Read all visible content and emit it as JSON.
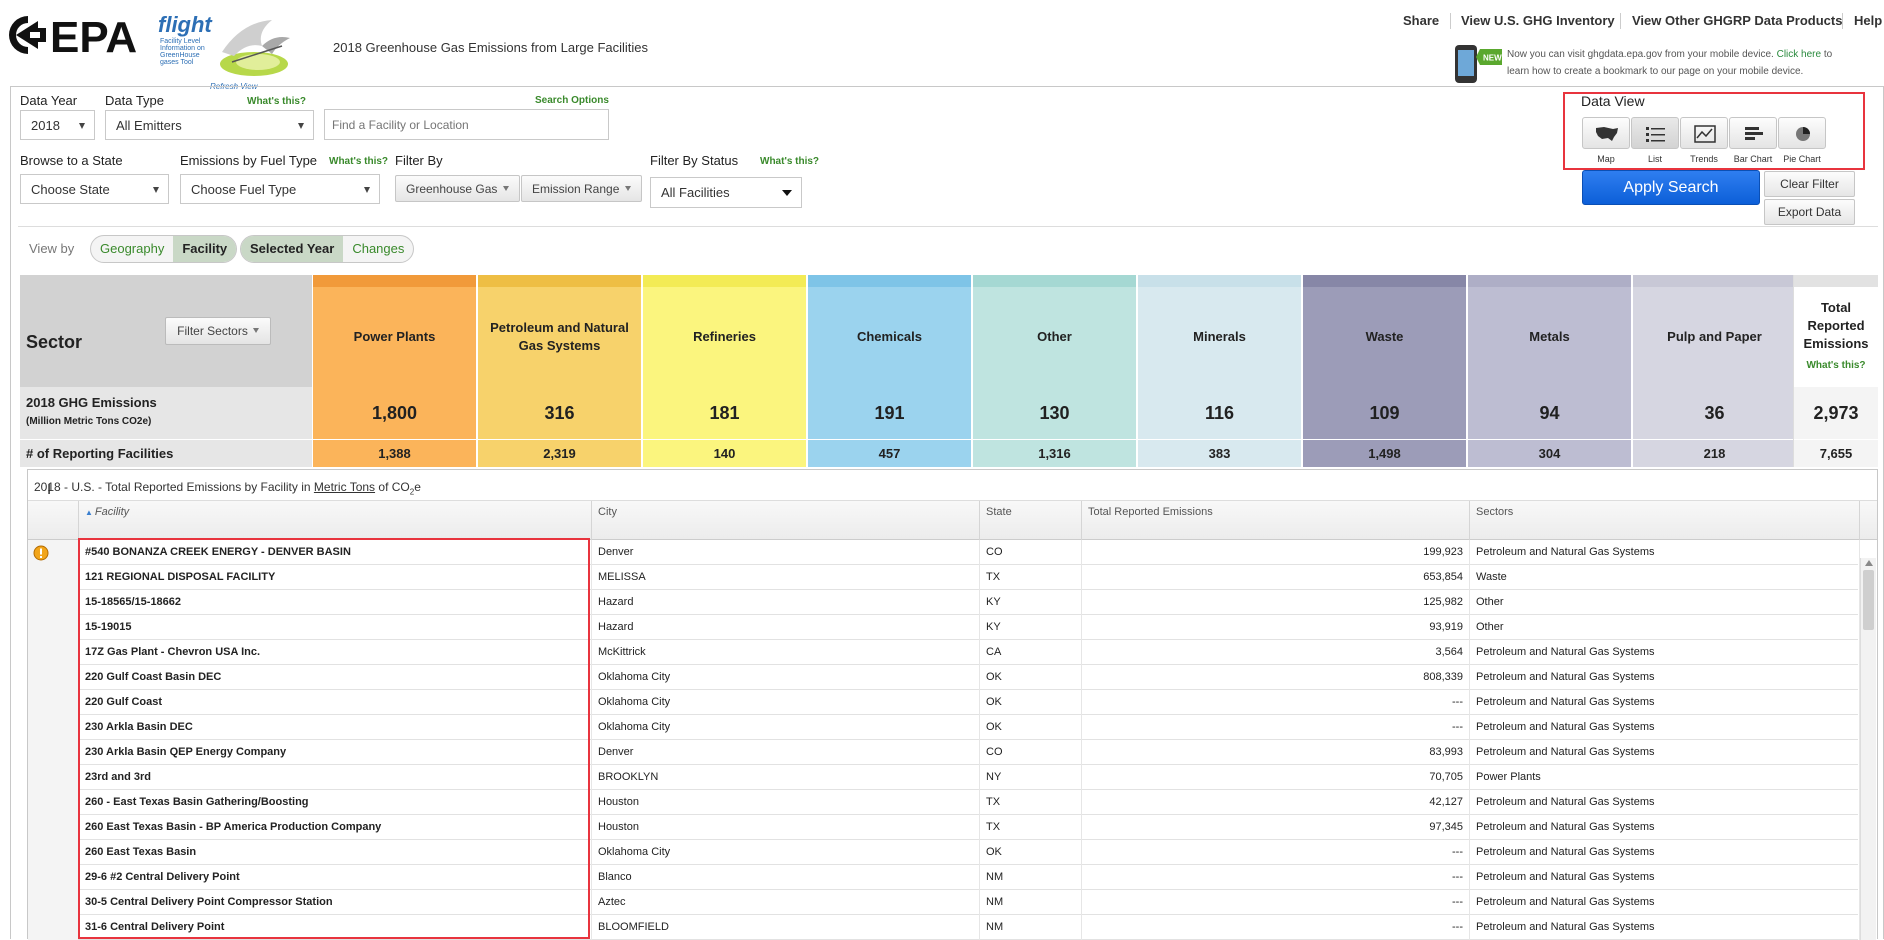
{
  "header": {
    "epa_logo": "EPA",
    "flight_word": "flight",
    "flight_sub": "Facility Level Information on GreenHouse gases Tool",
    "refresh_view": "Refresh View",
    "page_title": "2018 Greenhouse Gas Emissions from Large Facilities",
    "links": [
      "Share",
      "View U.S. GHG Inventory",
      "View Other GHGRP Data Products",
      "Help"
    ],
    "mobile_badge": "NEW!",
    "mobile_text": "Now you can visit ghgdata.epa.gov from your mobile device.",
    "mobile_link": "Click here",
    "mobile_text2": "to learn how to create a bookmark to our page on your mobile device."
  },
  "filters": {
    "data_year_label": "Data Year",
    "data_year_value": "2018",
    "data_type_label": "Data Type",
    "whats_this": "What's this?",
    "data_type_value": "All Emitters",
    "search_options": "Search Options",
    "search_placeholder": "Find a Facility or Location",
    "browse_state_label": "Browse to a State",
    "browse_state_value": "Choose State",
    "fuel_type_label": "Emissions by Fuel Type",
    "fuel_type_value": "Choose Fuel Type",
    "filter_by_label": "Filter By",
    "greenhouse_gas": "Greenhouse Gas",
    "emission_range": "Emission Range",
    "filter_status_label": "Filter By Status",
    "filter_status_value": "All Facilities"
  },
  "data_view": {
    "title": "Data View",
    "buttons": [
      {
        "label": "Map",
        "icon": "us-map-icon"
      },
      {
        "label": "List",
        "icon": "list-icon"
      },
      {
        "label": "Trends",
        "icon": "trends-icon"
      },
      {
        "label": "Bar Chart",
        "icon": "bar-chart-icon"
      },
      {
        "label": "Pie Chart",
        "icon": "pie-chart-icon"
      }
    ],
    "active": "List",
    "apply_search": "Apply Search",
    "clear_filter": "Clear Filter",
    "export_data": "Export Data"
  },
  "view_by": {
    "label": "View by",
    "geography": "Geography",
    "facility": "Facility",
    "selected_year": "Selected Year",
    "changes": "Changes"
  },
  "sector_table": {
    "sector_label": "Sector",
    "filter_sectors": "Filter Sectors",
    "emissions_row_label": "2018 GHG Emissions",
    "emissions_row_unit": "(Million Metric Tons CO2e)",
    "facilities_row_label": "# of Reporting Facilities",
    "total_label": "Total Reported Emissions",
    "total_whats_this": "What's this?",
    "total_emissions": "2,973",
    "total_facilities": "7,655",
    "sectors": [
      {
        "name": "Power Plants",
        "emissions": "1,800",
        "facilities": "1,388",
        "color": "#fbb45a",
        "band": "#f19a3a"
      },
      {
        "name": "Petroleum and Natural Gas Systems",
        "emissions": "316",
        "facilities": "2,319",
        "color": "#f7d26b",
        "band": "#eebe44"
      },
      {
        "name": "Refineries",
        "emissions": "181",
        "facilities": "140",
        "color": "#fbf57e",
        "band": "#f3eb55"
      },
      {
        "name": "Chemicals",
        "emissions": "191",
        "facilities": "457",
        "color": "#9bd3ee",
        "band": "#7ec4e7"
      },
      {
        "name": "Other",
        "emissions": "130",
        "facilities": "1,316",
        "color": "#bfe4e0",
        "band": "#a5d8d3"
      },
      {
        "name": "Minerals",
        "emissions": "116",
        "facilities": "383",
        "color": "#d8e9ef",
        "band": "#c8e0e9"
      },
      {
        "name": "Waste",
        "emissions": "109",
        "facilities": "1,498",
        "color": "#9c9cb8",
        "band": "#8787a7"
      },
      {
        "name": "Metals",
        "emissions": "94",
        "facilities": "304",
        "color": "#bdbdd2",
        "band": "#aeaec6"
      },
      {
        "name": "Pulp and Paper",
        "emissions": "36",
        "facilities": "218",
        "color": "#d6d6e1",
        "band": "#c8c8d6"
      }
    ]
  },
  "grid": {
    "caption_prefix": "2018 - U.S. - Total Reported Emissions by Facility in",
    "caption_unit": "Metric Tons",
    "caption_suffix": "of CO",
    "caption_sub": "2",
    "caption_end": "e",
    "columns": [
      "Facility",
      "City",
      "State",
      "Total Reported Emissions",
      "Sectors"
    ],
    "rows": [
      [
        "#540 BONANZA CREEK ENERGY - DENVER BASIN",
        "Denver",
        "CO",
        "199,923",
        "Petroleum and Natural Gas Systems"
      ],
      [
        "121 REGIONAL DISPOSAL FACILITY",
        "MELISSA",
        "TX",
        "653,854",
        "Waste"
      ],
      [
        "15-18565/15-18662",
        "Hazard",
        "KY",
        "125,982",
        "Other"
      ],
      [
        "15-19015",
        "Hazard",
        "KY",
        "93,919",
        "Other"
      ],
      [
        "17Z Gas Plant - Chevron USA Inc.",
        "McKittrick",
        "CA",
        "3,564",
        "Petroleum and Natural Gas Systems"
      ],
      [
        "220 Gulf Coast Basin DEC",
        "Oklahoma City",
        "OK",
        "808,339",
        "Petroleum and Natural Gas Systems"
      ],
      [
        "220 Gulf Coast",
        "Oklahoma City",
        "OK",
        "---",
        "Petroleum and Natural Gas Systems"
      ],
      [
        "230 Arkla Basin DEC",
        "Oklahoma City",
        "OK",
        "---",
        "Petroleum and Natural Gas Systems"
      ],
      [
        "230 Arkla Basin QEP Energy Company",
        "Denver",
        "CO",
        "83,993",
        "Petroleum and Natural Gas Systems"
      ],
      [
        "23rd and 3rd",
        "BROOKLYN",
        "NY",
        "70,705",
        "Power Plants"
      ],
      [
        "260 - East Texas Basin Gathering/Boosting",
        "Houston",
        "TX",
        "42,127",
        "Petroleum and Natural Gas Systems"
      ],
      [
        "260 East Texas Basin - BP America Production Company",
        "Houston",
        "TX",
        "97,345",
        "Petroleum and Natural Gas Systems"
      ],
      [
        "260 East Texas Basin",
        "Oklahoma City",
        "OK",
        "---",
        "Petroleum and Natural Gas Systems"
      ],
      [
        "29-6 #2 Central Delivery Point",
        "Blanco",
        "NM",
        "---",
        "Petroleum and Natural Gas Systems"
      ],
      [
        "30-5 Central Delivery Point Compressor Station",
        "Aztec",
        "NM",
        "---",
        "Petroleum and Natural Gas Systems"
      ],
      [
        "31-6 Central Delivery Point",
        "BLOOMFIELD",
        "NM",
        "---",
        "Petroleum and Natural Gas Systems"
      ]
    ]
  }
}
